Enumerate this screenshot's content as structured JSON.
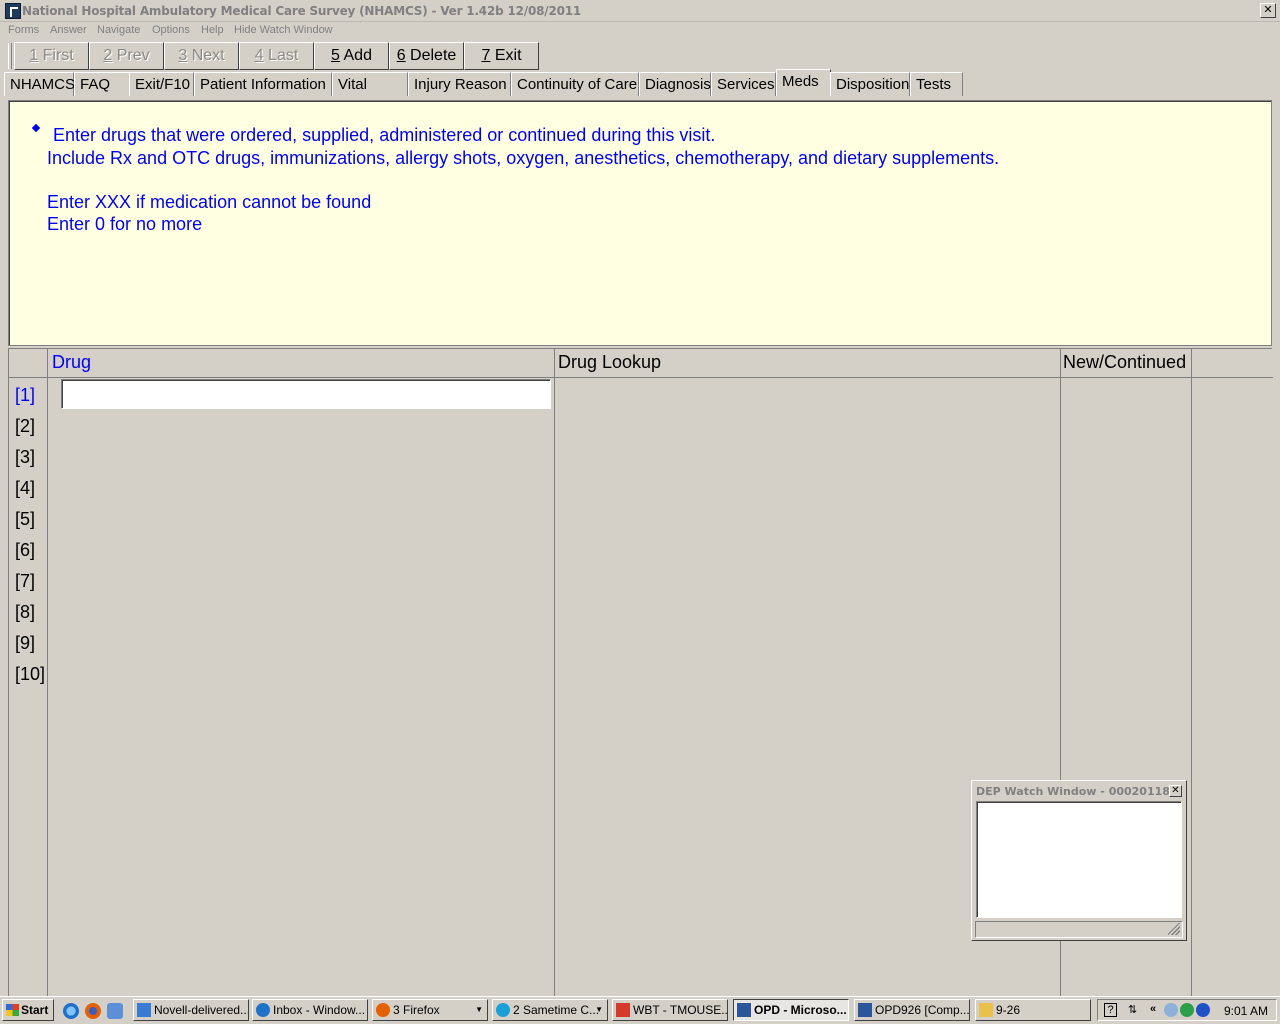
{
  "window": {
    "title": "National Hospital Ambulatory Medical Care Survey (NHAMCS) - Ver 1.42b 12/08/2011",
    "close_glyph": "✕"
  },
  "menu": [
    "Forms",
    "Answer",
    "Navigate",
    "Options",
    "Help",
    "Hide Watch Window"
  ],
  "toolbar": {
    "buttons": [
      {
        "key": "1",
        "label": " First",
        "enabled": false
      },
      {
        "key": "2",
        "label": " Prev",
        "enabled": false
      },
      {
        "key": "3",
        "label": " Next",
        "enabled": false
      },
      {
        "key": "4",
        "label": " Last",
        "enabled": false
      },
      {
        "key": "5",
        "label": " Add",
        "enabled": true
      },
      {
        "key": "6",
        "label": " Delete",
        "enabled": true
      },
      {
        "key": "7",
        "label": " Exit",
        "enabled": true
      }
    ]
  },
  "tabs": [
    {
      "label": "NHAMCS",
      "active": false
    },
    {
      "label": "FAQ",
      "active": false
    },
    {
      "label": "Exit/F10",
      "active": false
    },
    {
      "label": "Patient Information",
      "active": false
    },
    {
      "label": "Vital Signs",
      "active": false
    },
    {
      "label": "Injury Reason",
      "active": false
    },
    {
      "label": "Continuity of Care",
      "active": false
    },
    {
      "label": "Diagnosis",
      "active": false
    },
    {
      "label": "Services",
      "active": false
    },
    {
      "label": "Meds",
      "active": true
    },
    {
      "label": "Disposition",
      "active": false
    },
    {
      "label": "Tests",
      "active": false
    }
  ],
  "instructions": {
    "line1": "Enter drugs that were ordered, supplied, administered or continued during this visit.",
    "line2": "Include Rx and OTC drugs, immunizations, allergy shots, oxygen, anesthetics, chemotherapy, and dietary supplements.",
    "line3": "Enter XXX if medication cannot be found",
    "line4": "Enter 0 for no more"
  },
  "grid": {
    "headers": {
      "drug": "Drug",
      "drug_lookup": "Drug Lookup",
      "new_continued": "New/Continued"
    },
    "rows": [
      "[1]",
      "[2]",
      "[3]",
      "[4]",
      "[5]",
      "[6]",
      "[7]",
      "[8]",
      "[9]",
      "[10]"
    ],
    "drug_input_value": "",
    "active_row": 0
  },
  "watch_window": {
    "title": "DEP Watch Window - 00020118",
    "close_glyph": "✕",
    "content": ""
  },
  "taskbar": {
    "start_label": "Start",
    "tasks": [
      {
        "label": "Novell-delivered...",
        "active": false,
        "icon_color": "#3a7bd5"
      },
      {
        "label": "Inbox - Window...",
        "active": false,
        "icon_color": "#1e73c8"
      },
      {
        "label": "3 Firefox",
        "active": false,
        "icon_color": "#e66000",
        "dropdown": true
      },
      {
        "label": "2 Sametime C...",
        "active": false,
        "icon_color": "#1aa0d8",
        "dropdown": true
      },
      {
        "label": "WBT - TMOUSE...",
        "active": false,
        "icon_color": "#d43a2a"
      },
      {
        "label": "OPD - Microso...",
        "active": true,
        "icon_color": "#2b579a"
      },
      {
        "label": "OPD926 [Comp...",
        "active": false,
        "icon_color": "#2b579a"
      },
      {
        "label": "9-26",
        "active": false,
        "icon_color": "#e8c04a"
      }
    ],
    "tray_expand": "«",
    "clock": "9:01 AM"
  }
}
